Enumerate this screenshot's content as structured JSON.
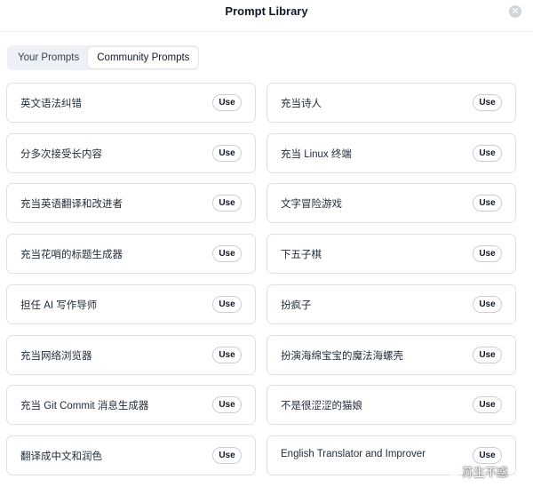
{
  "header": {
    "title": "Prompt Library",
    "close_icon": "close-icon"
  },
  "tabs": [
    {
      "label": "Your Prompts",
      "active": false
    },
    {
      "label": "Community Prompts",
      "active": true
    }
  ],
  "use_label": "Use",
  "prompts": [
    "英文语法纠错",
    "充当诗人",
    "分多次接受长内容",
    "充当 Linux 终端",
    "充当英语翻译和改进者",
    "文字冒险游戏",
    "充当花哨的标题生成器",
    "下五子棋",
    "担任 AI 写作导师",
    "扮疯子",
    "充当网络浏览器",
    "扮演海绵宝宝的魔法海螺壳",
    "充当 Git Commit 消息生成器",
    "不是很涩涩的猫娘",
    "翻译成中文和润色",
    "English Translator and Improver"
  ],
  "watermark": {
    "text": "苏生不惑",
    "icon": "wechat-icon"
  }
}
